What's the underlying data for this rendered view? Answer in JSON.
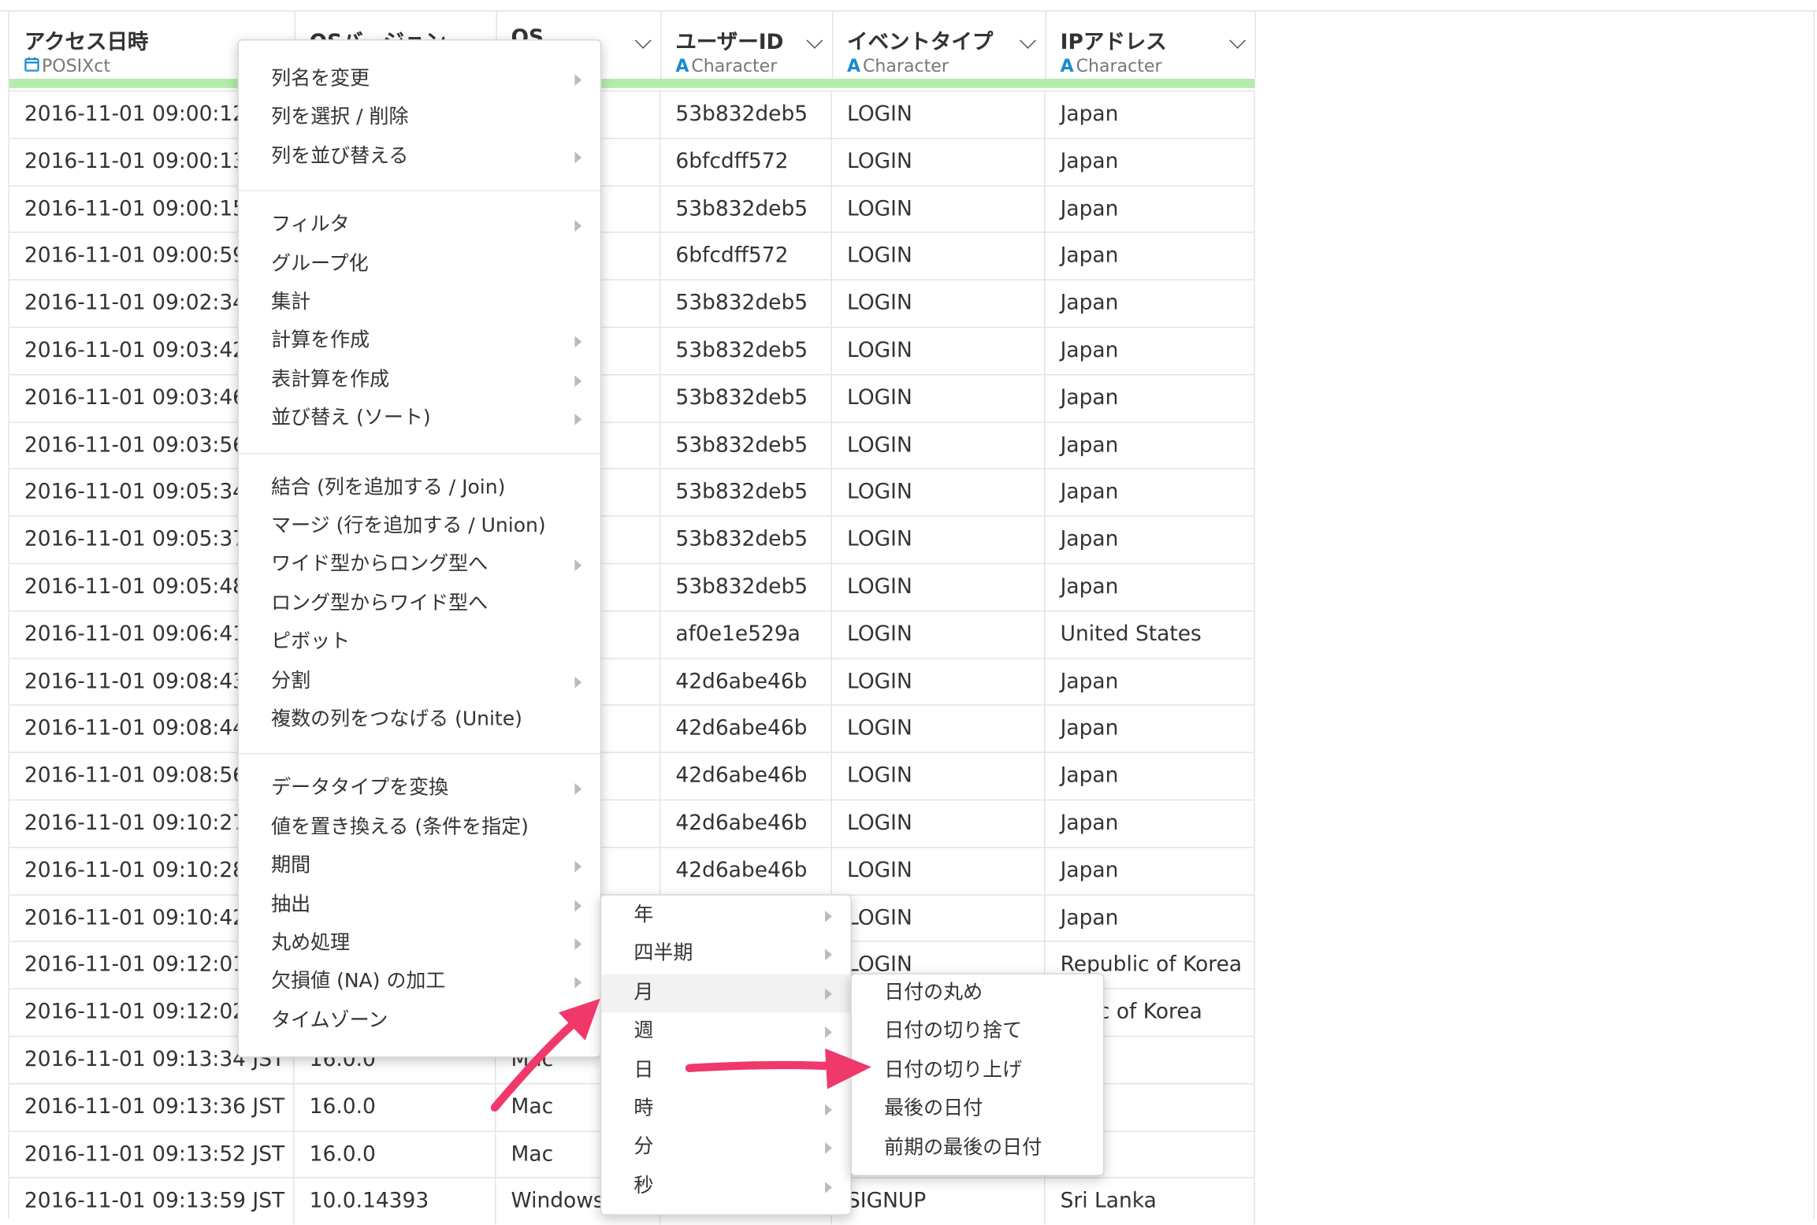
{
  "columns": [
    {
      "name": "アクセス日時",
      "type": "POSIXct",
      "type_icon": "calendar-icon"
    },
    {
      "name": "OSバージョン",
      "type": "",
      "type_icon": ""
    },
    {
      "name": "OS",
      "type": "er",
      "type_icon": ""
    },
    {
      "name": "ユーザーID",
      "type": "Character",
      "type_icon": "character-type-icon"
    },
    {
      "name": "イベントタイプ",
      "type": "Character",
      "type_icon": "character-type-icon"
    },
    {
      "name": "IPアドレス",
      "type": "Character",
      "type_icon": "character-type-icon"
    }
  ],
  "rows": [
    [
      "2016-11-01 09:00:12",
      "",
      "",
      "53b832deb5",
      "LOGIN",
      "Japan"
    ],
    [
      "2016-11-01 09:00:13",
      "",
      "s",
      "6bfcdff572",
      "LOGIN",
      "Japan"
    ],
    [
      "2016-11-01 09:00:15",
      "",
      "",
      "53b832deb5",
      "LOGIN",
      "Japan"
    ],
    [
      "2016-11-01 09:00:59",
      "",
      "s",
      "6bfcdff572",
      "LOGIN",
      "Japan"
    ],
    [
      "2016-11-01 09:02:34",
      "",
      "",
      "53b832deb5",
      "LOGIN",
      "Japan"
    ],
    [
      "2016-11-01 09:03:42",
      "",
      "",
      "53b832deb5",
      "LOGIN",
      "Japan"
    ],
    [
      "2016-11-01 09:03:46",
      "",
      "",
      "53b832deb5",
      "LOGIN",
      "Japan"
    ],
    [
      "2016-11-01 09:03:56",
      "",
      "",
      "53b832deb5",
      "LOGIN",
      "Japan"
    ],
    [
      "2016-11-01 09:05:34",
      "",
      "",
      "53b832deb5",
      "LOGIN",
      "Japan"
    ],
    [
      "2016-11-01 09:05:37",
      "",
      "",
      "53b832deb5",
      "LOGIN",
      "Japan"
    ],
    [
      "2016-11-01 09:05:48",
      "",
      "",
      "53b832deb5",
      "LOGIN",
      "Japan"
    ],
    [
      "2016-11-01 09:06:41",
      "",
      "",
      "af0e1e529a",
      "LOGIN",
      "United States"
    ],
    [
      "2016-11-01 09:08:43",
      "",
      "s",
      "42d6abe46b",
      "LOGIN",
      "Japan"
    ],
    [
      "2016-11-01 09:08:44",
      "",
      "s",
      "42d6abe46b",
      "LOGIN",
      "Japan"
    ],
    [
      "2016-11-01 09:08:56",
      "",
      "s",
      "42d6abe46b",
      "LOGIN",
      "Japan"
    ],
    [
      "2016-11-01 09:10:27",
      "",
      "s",
      "42d6abe46b",
      "LOGIN",
      "Japan"
    ],
    [
      "2016-11-01 09:10:28",
      "",
      "s",
      "42d6abe46b",
      "LOGIN",
      "Japan"
    ],
    [
      "2016-11-01 09:10:42",
      "",
      "",
      "",
      "LOGIN",
      "Japan"
    ],
    [
      "2016-11-01 09:12:01",
      "",
      "",
      "",
      "LOGIN",
      "Republic of Korea"
    ],
    [
      "2016-11-01 09:12:02",
      "",
      "",
      "",
      "",
      "ublic of Korea"
    ],
    [
      "2016-11-01 09:13:34 JST",
      "16.0.0",
      "Mac",
      "",
      "",
      "an"
    ],
    [
      "2016-11-01 09:13:36 JST",
      "16.0.0",
      "Mac",
      "",
      "",
      "an"
    ],
    [
      "2016-11-01 09:13:52 JST",
      "16.0.0",
      "Mac",
      "",
      "",
      "an"
    ],
    [
      "2016-11-01 09:13:59 JST",
      "10.0.14393",
      "Windows",
      "",
      "SIGNUP",
      "Sri Lanka"
    ]
  ],
  "context_menu": {
    "groups": [
      [
        {
          "label": "列名を変更",
          "submenu": true
        },
        {
          "label": "列を選択 / 削除",
          "submenu": false
        },
        {
          "label": "列を並び替える",
          "submenu": true
        }
      ],
      [
        {
          "label": "フィルタ",
          "submenu": true
        },
        {
          "label": "グループ化",
          "submenu": false
        },
        {
          "label": "集計",
          "submenu": false
        },
        {
          "label": "計算を作成",
          "submenu": true
        },
        {
          "label": "表計算を作成",
          "submenu": true
        },
        {
          "label": "並び替え (ソート)",
          "submenu": true
        }
      ],
      [
        {
          "label": "結合 (列を追加する / Join)",
          "submenu": false
        },
        {
          "label": "マージ (行を追加する / Union)",
          "submenu": false
        },
        {
          "label": "ワイド型からロング型へ",
          "submenu": true
        },
        {
          "label": "ロング型からワイド型へ",
          "submenu": false
        },
        {
          "label": "ピボット",
          "submenu": false
        },
        {
          "label": "分割",
          "submenu": true
        },
        {
          "label": "複数の列をつなげる (Unite)",
          "submenu": false
        }
      ],
      [
        {
          "label": "データタイプを変換",
          "submenu": true
        },
        {
          "label": "値を置き換える (条件を指定)",
          "submenu": false
        },
        {
          "label": "期間",
          "submenu": true
        },
        {
          "label": "抽出",
          "submenu": true
        },
        {
          "label": "丸め処理",
          "submenu": true
        },
        {
          "label": "欠損値 (NA) の加工",
          "submenu": true
        },
        {
          "label": "タイムゾーン",
          "submenu": false
        }
      ]
    ]
  },
  "round_submenu": {
    "items": [
      {
        "label": "年",
        "submenu": true
      },
      {
        "label": "四半期",
        "submenu": true
      },
      {
        "label": "月",
        "submenu": true,
        "selected": true
      },
      {
        "label": "週",
        "submenu": true
      },
      {
        "label": "日",
        "submenu": false
      },
      {
        "label": "時",
        "submenu": true
      },
      {
        "label": "分",
        "submenu": true
      },
      {
        "label": "秒",
        "submenu": true
      }
    ]
  },
  "month_submenu": {
    "items": [
      {
        "label": "日付の丸め"
      },
      {
        "label": "日付の切り捨て"
      },
      {
        "label": "日付の切り上げ"
      },
      {
        "label": "最後の日付"
      },
      {
        "label": "前期の最後の日付"
      }
    ]
  },
  "colors": {
    "quality_bar": "#b5ecae",
    "annotation_arrow": "#f0386b",
    "type_icon": "#1a8ad0"
  }
}
